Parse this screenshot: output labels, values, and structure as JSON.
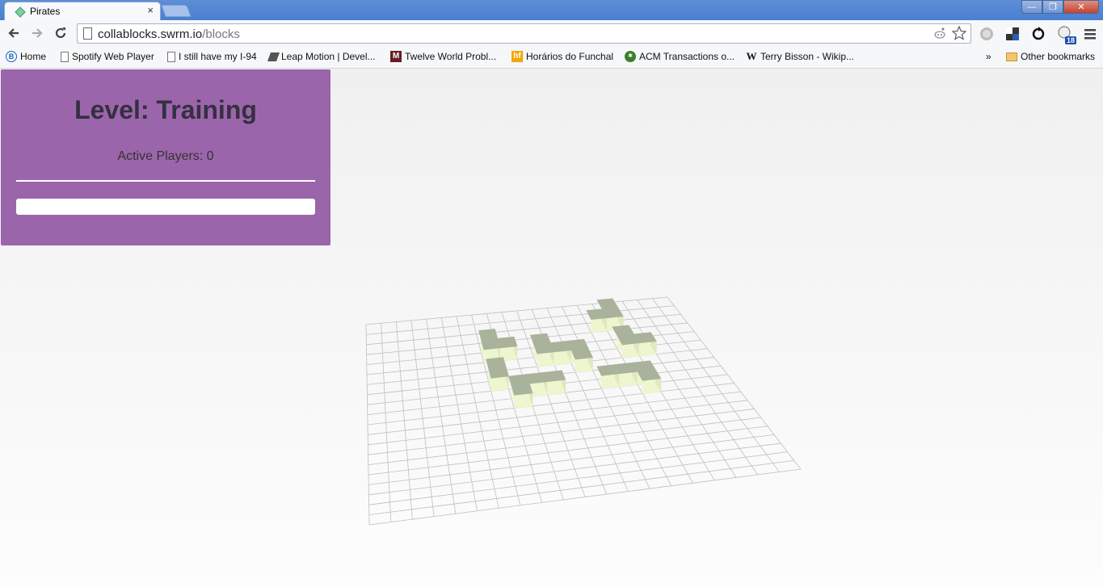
{
  "browser": {
    "tab": {
      "title": "Pirates",
      "close": "×"
    },
    "window": {
      "minimize": "—",
      "restore": "❐",
      "close": "✕"
    },
    "url": {
      "host": "collablocks.swrm.io",
      "path": "/blocks"
    },
    "extension_badge": "18"
  },
  "bookmarks": {
    "items": [
      {
        "label": "Home",
        "icon": "bitly-icon"
      },
      {
        "label": "Spotify Web Player",
        "icon": "page-icon"
      },
      {
        "label": "I still have my I-94",
        "icon": "page-icon"
      },
      {
        "label": "Leap Motion | Devel...",
        "icon": "leap-icon"
      },
      {
        "label": "Twelve World Probl...",
        "icon": "m-icon"
      },
      {
        "label": "Horários do Funchal",
        "icon": "hf-icon"
      },
      {
        "label": "ACM Transactions o...",
        "icon": "acm-icon"
      },
      {
        "label": "Terry Bisson - Wikip...",
        "icon": "wikipedia-icon"
      }
    ],
    "overflow": "»",
    "other": "Other bookmarks"
  },
  "panel": {
    "title": "Level: Training",
    "active_players": "Active Players: 0",
    "input_value": ""
  },
  "colors": {
    "panel": "#9b65ab",
    "block_top": "#a9b29b",
    "block_side": "#eef6cf",
    "grid_line": "#bfbfbf"
  },
  "board": {
    "grid_size": 20,
    "cells": [
      [
        7,
        3
      ],
      [
        7,
        4
      ],
      [
        8,
        4
      ],
      [
        7,
        6
      ],
      [
        7,
        7
      ],
      [
        8,
        8
      ],
      [
        9,
        8
      ],
      [
        10,
        8
      ],
      [
        8,
        9
      ],
      [
        10,
        4
      ],
      [
        10,
        5
      ],
      [
        11,
        5
      ],
      [
        12,
        5
      ],
      [
        12,
        6
      ],
      [
        14,
        2
      ],
      [
        15,
        2
      ],
      [
        15,
        1
      ],
      [
        15,
        4
      ],
      [
        15,
        5
      ],
      [
        16,
        5
      ],
      [
        13,
        8
      ],
      [
        14,
        8
      ],
      [
        15,
        8
      ],
      [
        15,
        9
      ]
    ]
  }
}
